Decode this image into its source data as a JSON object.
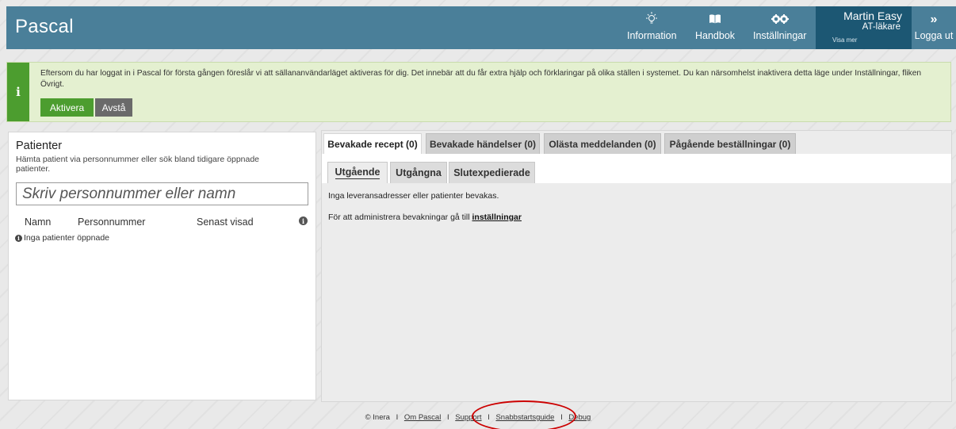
{
  "header": {
    "title": "Pascal",
    "nav": [
      {
        "label": "Information",
        "icon": "lightbulb-icon"
      },
      {
        "label": "Handbok",
        "icon": "book-icon"
      },
      {
        "label": "Inställningar",
        "icon": "gears-icon"
      }
    ],
    "user": {
      "name": "Martin Easy",
      "role": "AT-läkare",
      "more": "Visa mer"
    },
    "logout": {
      "label": "Logga ut",
      "icon": "double-chevron-right-icon"
    },
    "color": "#4a7f99",
    "user_color": "#1c5773"
  },
  "banner": {
    "icon": "info-icon",
    "text": "Eftersom du har loggat in i Pascal för första gången föreslår vi att sällananvändarläget aktiveras för dig. Det innebär att du får extra hjälp och förklaringar på olika ställen i systemet. Du kan närsomhelst inaktivera detta läge under Inställningar, fliken Övrigt.",
    "activate_label": "Aktivera",
    "decline_label": "Avstå",
    "color": "#e4f0d0"
  },
  "patients": {
    "title": "Patienter",
    "description": "Hämta patient via personnummer eller sök bland tidigare öppnade patienter.",
    "search_placeholder": "Skriv personnummer eller namn",
    "columns": [
      "Namn",
      "Personnummer",
      "Senast visad"
    ],
    "empty_text": "Inga patienter öppnade"
  },
  "main": {
    "tabs": [
      {
        "label": "Bevakade recept (0)",
        "active": true
      },
      {
        "label": "Bevakade händelser (0)",
        "active": false
      },
      {
        "label": "Olästa meddelanden (0)",
        "active": false
      },
      {
        "label": "Pågående beställningar (0)",
        "active": false
      }
    ],
    "subtabs": [
      {
        "label": "Utgående",
        "active": true
      },
      {
        "label": "Utgångna",
        "active": false
      },
      {
        "label": "Slutexpedierade",
        "active": false
      }
    ],
    "empty_text": "Inga leveransadresser eller patienter bevakas.",
    "admin_text": "För att administrera bevakningar gå till",
    "admin_link": "inställningar"
  },
  "footer": {
    "copyright": "© Inera",
    "links": [
      "Om Pascal",
      "Support",
      "Snabbstartsguide",
      "Debug"
    ],
    "separator": "I"
  }
}
